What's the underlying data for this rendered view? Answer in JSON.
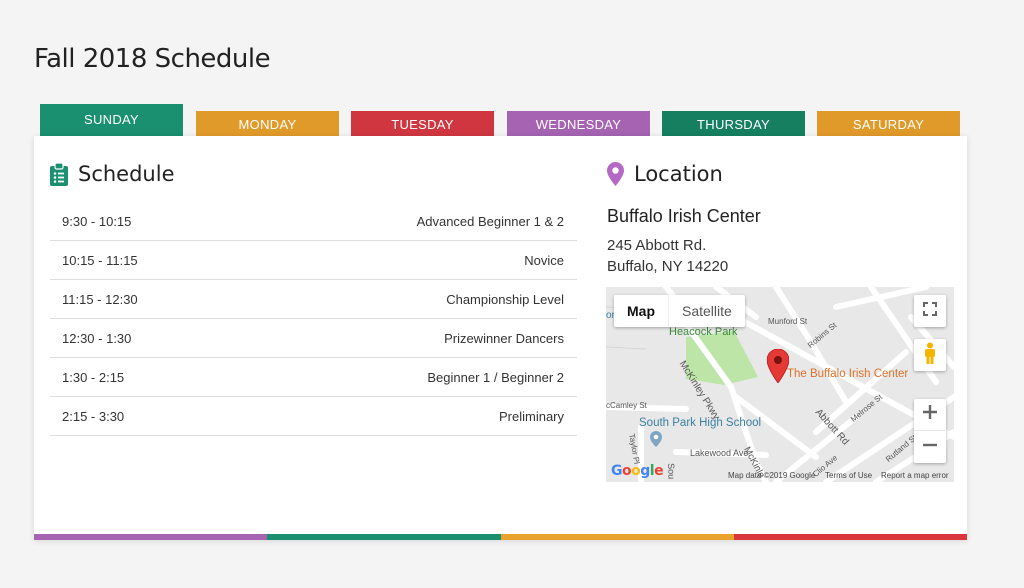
{
  "page": {
    "title": "Fall 2018 Schedule"
  },
  "tabs": [
    {
      "label": "SUNDAY",
      "color": "#1a9070",
      "active": true
    },
    {
      "label": "MONDAY",
      "color": "#e09a2a"
    },
    {
      "label": "TUESDAY",
      "color": "#cf3640"
    },
    {
      "label": "WEDNESDAY",
      "color": "#a563b2"
    },
    {
      "label": "THURSDAY",
      "color": "#157f60"
    },
    {
      "label": "SATURDAY",
      "color": "#e09a2a"
    }
  ],
  "schedule": {
    "heading": "Schedule",
    "icon": "clipboard-list-icon",
    "rows": [
      {
        "time": "9:30 - 10:15",
        "level": "Advanced Beginner 1 & 2"
      },
      {
        "time": "10:15 - 11:15",
        "level": "Novice"
      },
      {
        "time": "11:15 - 12:30",
        "level": "Championship Level"
      },
      {
        "time": "12:30 - 1:30",
        "level": "Prizewinner Dancers"
      },
      {
        "time": "1:30 - 2:15",
        "level": "Beginner 1 / Beginner 2"
      },
      {
        "time": "2:15 - 3:30",
        "level": "Preliminary"
      }
    ]
  },
  "location": {
    "heading": "Location",
    "icon": "map-pin-icon",
    "venue_name": "Buffalo Irish Center",
    "street": "245 Abbott Rd.",
    "city": "Buffalo, NY 14220"
  },
  "map": {
    "type_map": "Map",
    "type_satellite": "Satellite",
    "marker_label": "The Buffalo Irish Center",
    "labels": {
      "park": "Heacock Park",
      "school": "South Park High School",
      "mckinley_pkwy": "McKinley Pkwy",
      "abbott": "Abbott Rd",
      "munford": "Munford St",
      "robins": "Robins St",
      "melrose": "Melrose St",
      "rutland": "Rutland St",
      "lakewood": "Lakewood Ave",
      "mckinley": "McKinle",
      "taylor": "Taylor Pl",
      "mccamley": "cCamley St",
      "clio": "Clio Ave",
      "south": "Sou",
      "partial_or": "or"
    },
    "google": "Google",
    "attribution": "Map data ©2019 Google",
    "terms": "Terms of Use",
    "report": "Report a map error"
  },
  "colors": {
    "bottom_bar": [
      "#a563b2",
      "#1a9070",
      "#e9a32c",
      "#d9363e"
    ]
  }
}
